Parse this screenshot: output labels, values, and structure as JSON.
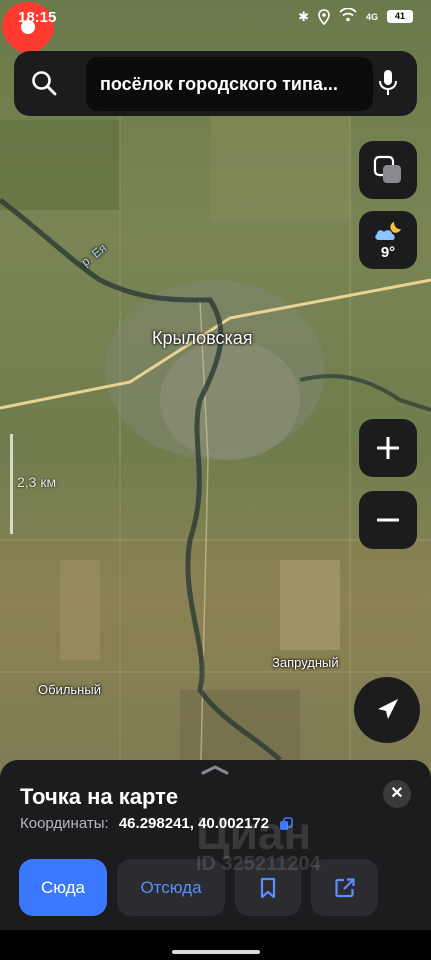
{
  "status_bar": {
    "time": "18:15",
    "network": "4G",
    "battery": "41"
  },
  "search": {
    "query": "посёлок городского типа..."
  },
  "weather": {
    "temperature": "9°",
    "icon": "partly-cloudy-night-icon"
  },
  "map": {
    "town": "Крыловская",
    "villages": [
      "Запрудный",
      "Обильный"
    ],
    "river": "р. Ея",
    "scale": "2,3 км"
  },
  "sheet": {
    "title": "Точка на карте",
    "coords_label": "Координаты:",
    "coords_value": "46.298241, 40.002172",
    "buttons": {
      "here": "Сюда",
      "from": "Отсюда"
    }
  },
  "watermark": {
    "brand": "Циан",
    "id": "ID 325211204"
  },
  "colors": {
    "accent": "#3a78ff",
    "pin": "#ff3b30",
    "panel": "#1c1c1e"
  }
}
